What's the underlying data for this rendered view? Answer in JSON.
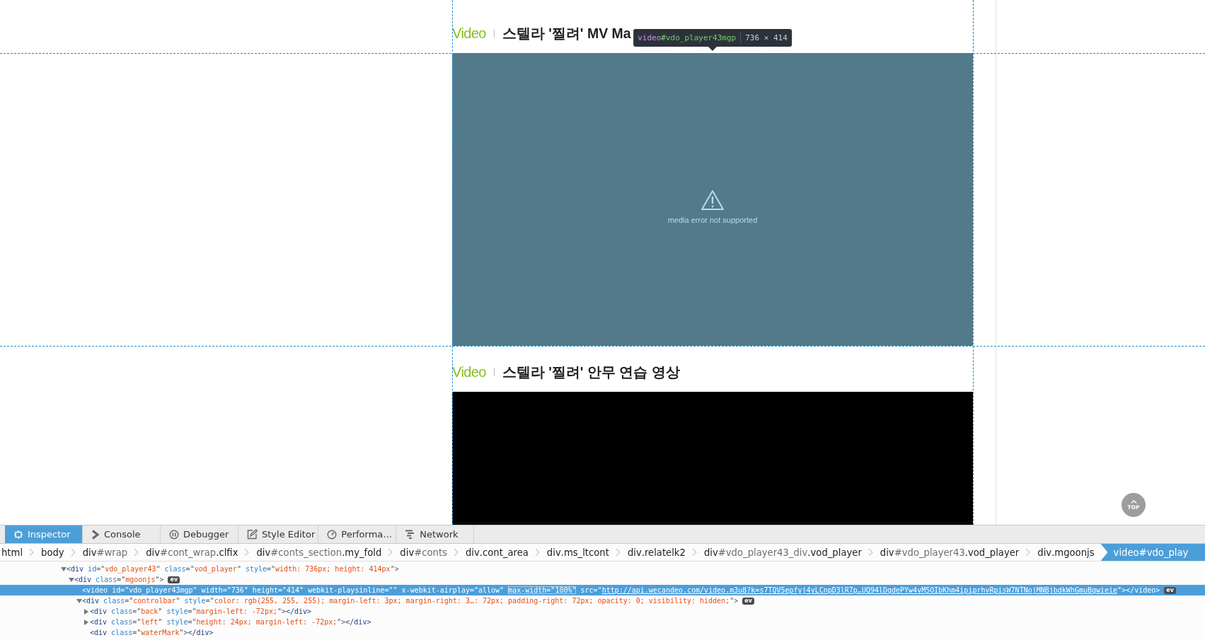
{
  "page": {
    "sections": [
      {
        "category": "Video",
        "title": "스텔라 '찔려' MV Ma",
        "player": {
          "kind": "error",
          "message": "media error not supported"
        }
      },
      {
        "category": "Video",
        "title": "스텔라 '찔려' 안무 연습 영상",
        "player": {
          "kind": "blank"
        }
      }
    ],
    "tooltip": {
      "tag": "video",
      "id": "#vdo_player43mgp",
      "size": "736 × 414"
    },
    "top_button": {
      "label": "TOP"
    }
  },
  "devtools": {
    "tabs": [
      {
        "label": "Inspector",
        "selected": true
      },
      {
        "label": "Console",
        "selected": false
      },
      {
        "label": "Debugger",
        "selected": false
      },
      {
        "label": "Style Editor",
        "selected": false
      },
      {
        "label": "Performa…",
        "selected": false
      },
      {
        "label": "Network",
        "selected": false
      }
    ],
    "breadcrumbs": [
      {
        "tag": "html",
        "selected": false
      },
      {
        "tag": "body",
        "selected": false
      },
      {
        "tag": "div",
        "id": "#wrap",
        "selected": false
      },
      {
        "tag": "div",
        "id": "#cont_wrap",
        "classes": ".clfix",
        "selected": false
      },
      {
        "tag": "div",
        "id": "#conts_section",
        "classes": ".my_fold",
        "selected": false
      },
      {
        "tag": "div",
        "id": "#conts",
        "selected": false
      },
      {
        "tag": "div",
        "classes": ".cont_area",
        "selected": false
      },
      {
        "tag": "div",
        "classes": ".ms_ltcont",
        "selected": false
      },
      {
        "tag": "div",
        "classes": ".relatelk2",
        "selected": false
      },
      {
        "tag": "div",
        "id": "#vdo_player43_div",
        "classes": ".vod_player",
        "selected": false
      },
      {
        "tag": "div",
        "id": "#vdo_player43",
        "classes": ".vod_player",
        "selected": false
      },
      {
        "tag": "div",
        "classes": ".mgoonjs",
        "selected": false
      },
      {
        "tag": "video",
        "id": "#vdo_play",
        "selected": true
      }
    ],
    "markup": [
      {
        "kind": "open",
        "selected": false,
        "tokens": [
          {
            "kind": "tag",
            "text": "<div"
          },
          {
            "kind": "attr",
            "text": " id"
          },
          {
            "kind": "punct",
            "text": "=\""
          },
          {
            "kind": "value",
            "text": "vdo_player43"
          },
          {
            "kind": "punct",
            "text": "\""
          },
          {
            "kind": "attr",
            "text": " class"
          },
          {
            "kind": "punct",
            "text": "=\""
          },
          {
            "kind": "value",
            "text": "vod_player"
          },
          {
            "kind": "punct",
            "text": "\""
          },
          {
            "kind": "attr",
            "text": " style"
          },
          {
            "kind": "punct",
            "text": "=\""
          },
          {
            "kind": "value",
            "text": "width: 736px; height: 414px"
          },
          {
            "kind": "punct",
            "text": "\">"
          }
        ],
        "children": [
          {
            "kind": "open",
            "selected": false,
            "badge": "ev",
            "tokens": [
              {
                "kind": "tag",
                "text": "<div"
              },
              {
                "kind": "attr",
                "text": " class"
              },
              {
                "kind": "punct",
                "text": "=\""
              },
              {
                "kind": "value",
                "text": "mgoonjs"
              },
              {
                "kind": "punct",
                "text": "\">"
              }
            ],
            "children": [
              {
                "kind": "leaf",
                "selected": true,
                "badge": "ev",
                "tokens": [
                  {
                    "kind": "tag",
                    "text": "<video"
                  },
                  {
                    "kind": "attr",
                    "text": " id"
                  },
                  {
                    "kind": "punct",
                    "text": "=\""
                  },
                  {
                    "kind": "value",
                    "text": "vdo_player43mgp"
                  },
                  {
                    "kind": "punct",
                    "text": "\""
                  },
                  {
                    "kind": "attr",
                    "text": " width"
                  },
                  {
                    "kind": "punct",
                    "text": "=\""
                  },
                  {
                    "kind": "value",
                    "text": "736"
                  },
                  {
                    "kind": "punct",
                    "text": "\""
                  },
                  {
                    "kind": "attr",
                    "text": " height"
                  },
                  {
                    "kind": "punct",
                    "text": "=\""
                  },
                  {
                    "kind": "value",
                    "text": "414"
                  },
                  {
                    "kind": "punct",
                    "text": "\""
                  },
                  {
                    "kind": "attr",
                    "text": " webkit-playsinline"
                  },
                  {
                    "kind": "punct",
                    "text": "=\"\""
                  },
                  {
                    "kind": "attr",
                    "text": " x-webkit-airplay"
                  },
                  {
                    "kind": "punct",
                    "text": "=\""
                  },
                  {
                    "kind": "value",
                    "text": "allow"
                  },
                  {
                    "kind": "punct",
                    "text": "\" "
                  },
                  {
                    "kind": "marked",
                    "text": "max-width=\"100%\""
                  },
                  {
                    "kind": "attr",
                    "text": " src"
                  },
                  {
                    "kind": "punct",
                    "text": "=\""
                  },
                  {
                    "kind": "link",
                    "text": "http://api.wecandeo.com/video.m3u8?k=s7TQV5epfyj4yLCnpD3lR7p…UQ94lDqdePYw4vM5OIbKhm4ipiprhvRpisW7NTNojMNBjbdkWhGmuBqwieie"
                  },
                  {
                    "kind": "punct",
                    "text": "\"></video>"
                  }
                ]
              },
              {
                "kind": "open",
                "selected": false,
                "badge": "ev",
                "tokens": [
                  {
                    "kind": "tag",
                    "text": "<div"
                  },
                  {
                    "kind": "attr",
                    "text": " class"
                  },
                  {
                    "kind": "punct",
                    "text": "=\""
                  },
                  {
                    "kind": "value",
                    "text": "controlbar"
                  },
                  {
                    "kind": "punct",
                    "text": "\""
                  },
                  {
                    "kind": "attr",
                    "text": " style"
                  },
                  {
                    "kind": "punct",
                    "text": "=\""
                  },
                  {
                    "kind": "value",
                    "text": "color: rgb(255, 255, 255); margin-left: 3px; margin-right: 3…: 72px; padding-right: 72px; opacity: 0; visibility: hidden;"
                  },
                  {
                    "kind": "punct",
                    "text": "\">"
                  }
                ],
                "children": [
                  {
                    "kind": "closed",
                    "selected": false,
                    "tokens": [
                      {
                        "kind": "tag",
                        "text": "<div"
                      },
                      {
                        "kind": "attr",
                        "text": " class"
                      },
                      {
                        "kind": "punct",
                        "text": "=\""
                      },
                      {
                        "kind": "value",
                        "text": "back"
                      },
                      {
                        "kind": "punct",
                        "text": "\""
                      },
                      {
                        "kind": "attr",
                        "text": " style"
                      },
                      {
                        "kind": "punct",
                        "text": "=\""
                      },
                      {
                        "kind": "value",
                        "text": "margin-left: -72px;"
                      },
                      {
                        "kind": "punct",
                        "text": "\">"
                      },
                      {
                        "kind": "tag",
                        "text": "</div>"
                      }
                    ]
                  },
                  {
                    "kind": "closed",
                    "selected": false,
                    "tokens": [
                      {
                        "kind": "tag",
                        "text": "<div"
                      },
                      {
                        "kind": "attr",
                        "text": " class"
                      },
                      {
                        "kind": "punct",
                        "text": "=\""
                      },
                      {
                        "kind": "value",
                        "text": "left"
                      },
                      {
                        "kind": "punct",
                        "text": "\""
                      },
                      {
                        "kind": "attr",
                        "text": " style"
                      },
                      {
                        "kind": "punct",
                        "text": "=\""
                      },
                      {
                        "kind": "value",
                        "text": "height: 24px; margin-left: -72px;"
                      },
                      {
                        "kind": "punct",
                        "text": "\">"
                      },
                      {
                        "kind": "tag",
                        "text": "</div>"
                      }
                    ]
                  },
                  {
                    "kind": "leaf",
                    "selected": false,
                    "tokens": [
                      {
                        "kind": "tag",
                        "text": "<div"
                      },
                      {
                        "kind": "attr",
                        "text": " class"
                      },
                      {
                        "kind": "punct",
                        "text": "=\""
                      },
                      {
                        "kind": "value",
                        "text": "waterMark"
                      },
                      {
                        "kind": "punct",
                        "text": "\">"
                      },
                      {
                        "kind": "tag",
                        "text": "</div>"
                      }
                    ]
                  }
                ]
              }
            ]
          }
        ]
      }
    ]
  }
}
